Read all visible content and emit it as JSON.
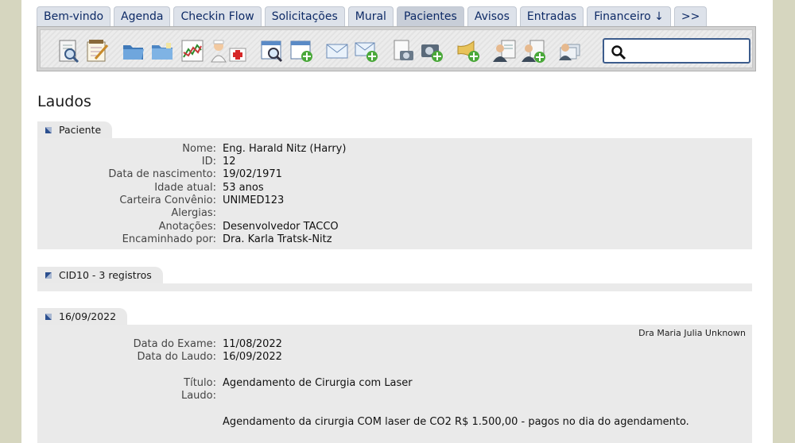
{
  "tabs": [
    {
      "label": "Bem-vindo"
    },
    {
      "label": "Agenda"
    },
    {
      "label": "Checkin Flow"
    },
    {
      "label": "Solicitações"
    },
    {
      "label": "Mural"
    },
    {
      "label": "Pacientes"
    },
    {
      "label": "Avisos"
    },
    {
      "label": "Entradas"
    },
    {
      "label": "Financeiro ↓"
    },
    {
      "label": ">>"
    }
  ],
  "search": {
    "value": "",
    "placeholder": ""
  },
  "page_title": "Laudos",
  "paciente": {
    "section_label": "Paciente",
    "fields": [
      {
        "label": "Nome:",
        "value": "Eng. Harald Nitz (Harry)"
      },
      {
        "label": "ID:",
        "value": "12"
      },
      {
        "label": "Data de nascimento:",
        "value": "19/02/1971"
      },
      {
        "label": "Idade atual:",
        "value": "53 anos"
      },
      {
        "label": "Carteira Convênio:",
        "value": "UNIMED123"
      },
      {
        "label": "Alergias:",
        "value": ""
      },
      {
        "label": "Anotações:",
        "value": "Desenvolvedor TACCO"
      },
      {
        "label": "Encaminhado por:",
        "value": "Dra. Karla Tratsk-Nitz"
      }
    ]
  },
  "cid10": {
    "section_label": "CID10 - 3 registros"
  },
  "laudo": {
    "section_label": "16/09/2022",
    "doctor": "Dra Maria Julia Unknown",
    "data_exame_label": "Data do Exame:",
    "data_exame": "11/08/2022",
    "data_laudo_label": "Data do Laudo:",
    "data_laudo": "16/09/2022",
    "titulo_label": "Título:",
    "titulo": "Agendamento de Cirurgia com Laser",
    "laudo_label": "Laudo:",
    "laudo_text": "Agendamento da cirurgia COM laser de CO2 R$ 1.500,00 - pagos no dia do agendamento."
  },
  "colors": {
    "tab_text": "#0d2a66",
    "page_bg": "#d6d6bf",
    "section_bg": "#eaeaea",
    "search_border": "#3c5c8c"
  }
}
